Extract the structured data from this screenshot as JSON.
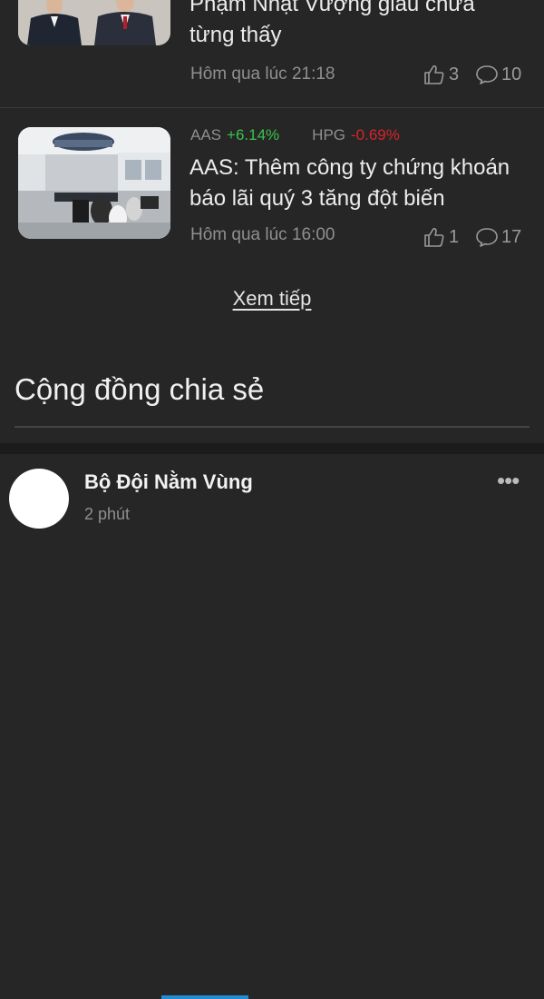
{
  "articles": [
    {
      "title_lines": [
        "Phạm Nhật Vượng giàu chưa",
        "từng thấy"
      ],
      "time": "Hôm qua lúc 21:18",
      "likes": "3",
      "comments": "10"
    },
    {
      "tickers": [
        {
          "symbol": "AAS",
          "change": "+6.14%",
          "direction": "up"
        },
        {
          "symbol": "HPG",
          "change": "-0.69%",
          "direction": "down"
        }
      ],
      "title_lines": [
        "AAS: Thêm công ty chứng khoán",
        "báo lãi quý 3 tăng đột biến"
      ],
      "time": "Hôm qua lúc 16:00",
      "likes": "1",
      "comments": "17"
    }
  ],
  "more_link": "Xem tiếp",
  "community": {
    "title": "Cộng đồng chia sẻ",
    "post": {
      "author": "Bộ Đội Nằm Vùng",
      "time": "2 phút",
      "menu_icon": "more-horizontal-icon"
    }
  },
  "colors": {
    "background": "#262626",
    "up": "#3bc24e",
    "down": "#d8232a",
    "accent": "#1e8fd6"
  }
}
